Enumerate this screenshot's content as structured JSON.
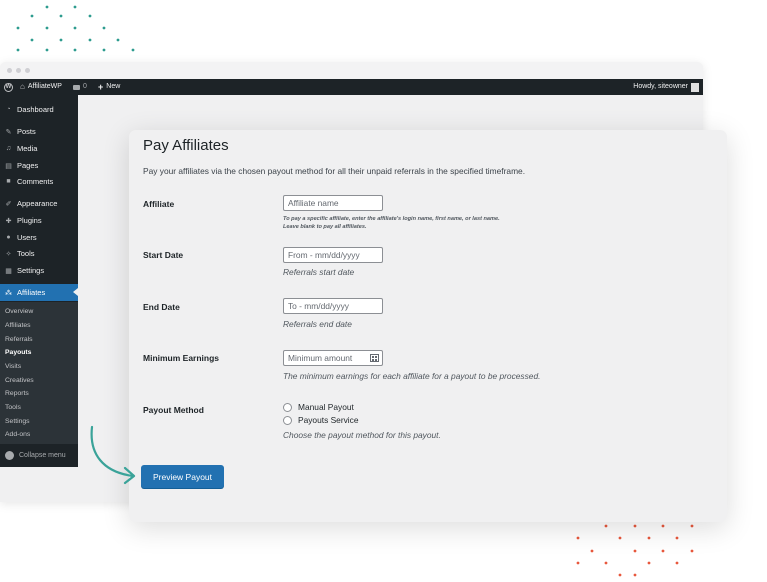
{
  "colors": {
    "accent": "#2271b1",
    "admin_bar": "#1d2327",
    "dots_teal": "#2e9c8f",
    "dots_red": "#e8583d",
    "arrow": "#3aa399"
  },
  "admin_bar": {
    "site_name": "AffiliateWP",
    "comments_count": "0",
    "new_label": "New",
    "greeting": "Howdy, siteowner"
  },
  "sidebar": {
    "items": [
      {
        "label": "Dashboard",
        "icon": "dashboard-icon"
      },
      {
        "label": "Posts",
        "icon": "pin-icon"
      },
      {
        "label": "Media",
        "icon": "media-icon"
      },
      {
        "label": "Pages",
        "icon": "pages-icon"
      },
      {
        "label": "Comments",
        "icon": "comment-icon"
      },
      {
        "label": "Appearance",
        "icon": "brush-icon"
      },
      {
        "label": "Plugins",
        "icon": "plugin-icon"
      },
      {
        "label": "Users",
        "icon": "user-icon"
      },
      {
        "label": "Tools",
        "icon": "wrench-icon"
      },
      {
        "label": "Settings",
        "icon": "settings-icon"
      },
      {
        "label": "Affiliates",
        "icon": "affiliates-icon"
      }
    ],
    "submenu": [
      "Overview",
      "Affiliates",
      "Referrals",
      "Payouts",
      "Visits",
      "Creatives",
      "Reports",
      "Tools",
      "Settings",
      "Add-ons"
    ],
    "collapse_label": "Collapse menu"
  },
  "form": {
    "title": "Pay Affiliates",
    "description": "Pay your affiliates via the chosen payout method for all their unpaid referrals in the specified timeframe.",
    "affiliate": {
      "label": "Affiliate",
      "placeholder": "Affiliate name",
      "hint_line1": "To pay a specific affiliate, enter the affiliate's login name, first name, or last name.",
      "hint_line2": "Leave blank to pay all affiliates."
    },
    "start_date": {
      "label": "Start Date",
      "placeholder": "From - mm/dd/yyyy",
      "hint": "Referrals start date"
    },
    "end_date": {
      "label": "End Date",
      "placeholder": "To - mm/dd/yyyy",
      "hint": "Referrals end date"
    },
    "min_earnings": {
      "label": "Minimum Earnings",
      "placeholder": "Minimum amount",
      "hint": "The minimum earnings for each affiliate for a payout to be processed."
    },
    "payout_method": {
      "label": "Payout Method",
      "options": [
        "Manual Payout",
        "Payouts Service"
      ],
      "hint": "Choose the payout method for this payout."
    },
    "preview_button": "Preview Payout"
  }
}
